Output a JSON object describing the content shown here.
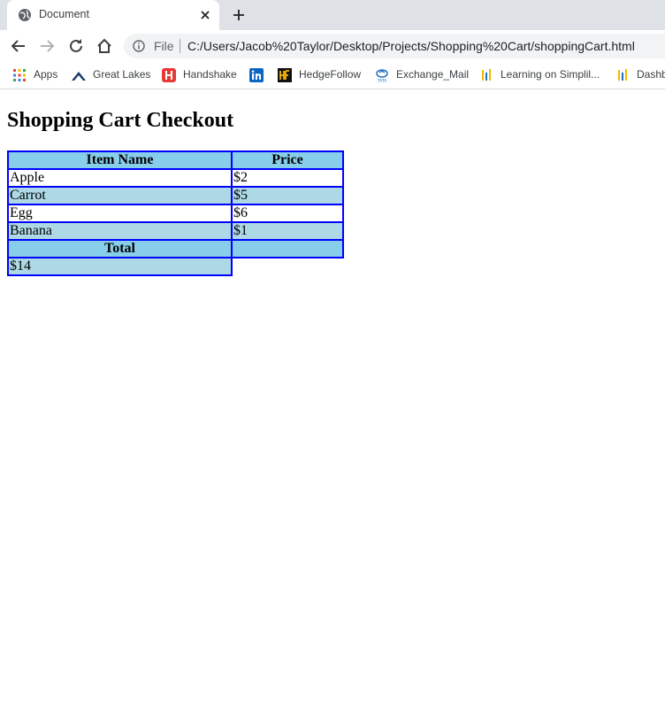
{
  "browser": {
    "tab": {
      "title": "Document"
    },
    "address": {
      "scheme": "File",
      "url": "C:/Users/Jacob%20Taylor/Desktop/Projects/Shopping%20Cart/shoppingCart.html"
    },
    "bookmarks": [
      {
        "label": "Apps",
        "icon": "apps-grid-icon"
      },
      {
        "label": "Great Lakes",
        "icon": "great-lakes-icon"
      },
      {
        "label": "Handshake",
        "icon": "handshake-icon"
      },
      {
        "label": "",
        "icon": "linkedin-icon"
      },
      {
        "label": "HedgeFollow",
        "icon": "hedgefollow-icon"
      },
      {
        "label": "Exchange_Mail",
        "icon": "tata-icon"
      },
      {
        "label": "Learning on Simplil...",
        "icon": "simplilearn-icon"
      },
      {
        "label": "Dashb",
        "icon": "dashboard-icon"
      }
    ]
  },
  "page": {
    "heading": "Shopping Cart Checkout",
    "table": {
      "headers": [
        "Item Name",
        "Price"
      ],
      "rows": [
        {
          "item": "Apple",
          "price": "$2"
        },
        {
          "item": "Carrot",
          "price": "$5"
        },
        {
          "item": "Egg",
          "price": "$6"
        },
        {
          "item": "Banana",
          "price": "$1"
        }
      ],
      "total_label": "Total",
      "total_value": "$14"
    },
    "colors": {
      "border": "#0000ff",
      "header_bg": "#87ceeb",
      "row_alt_bg": "#add8e6"
    }
  }
}
